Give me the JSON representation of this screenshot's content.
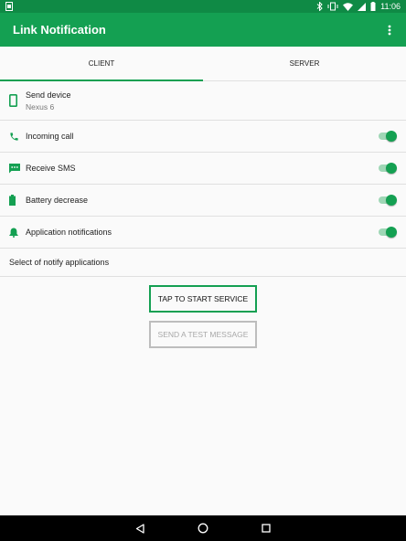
{
  "status_bar": {
    "time": "11:06"
  },
  "app_bar": {
    "title": "Link Notification"
  },
  "tabs": [
    {
      "label": "CLIENT",
      "active": true
    },
    {
      "label": "SERVER",
      "active": false
    }
  ],
  "device": {
    "label": "Send device",
    "value": "Nexus 6"
  },
  "settings": [
    {
      "label": "Incoming call",
      "enabled": true,
      "icon": "phone-icon"
    },
    {
      "label": "Receive SMS",
      "enabled": true,
      "icon": "sms-icon"
    },
    {
      "label": "Battery decrease",
      "enabled": true,
      "icon": "battery-icon"
    },
    {
      "label": "Application notifications",
      "enabled": true,
      "icon": "bell-icon"
    }
  ],
  "notify_apps": {
    "label": "Select of notify applications"
  },
  "actions": {
    "start_label": "TAP TO START SERVICE",
    "test_label": "SEND A TEST MESSAGE"
  },
  "colors": {
    "accent": "#14a052",
    "status_bar": "#0f8a45",
    "disabled": "#bdbdbd"
  }
}
